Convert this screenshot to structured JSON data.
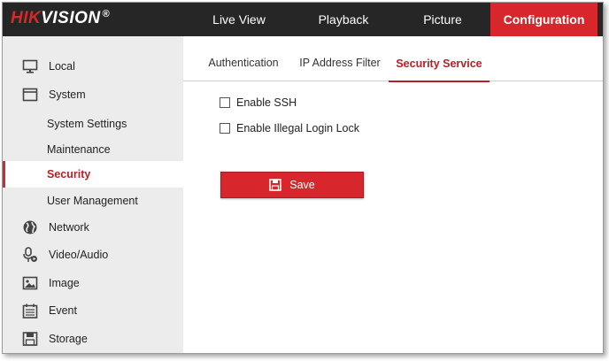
{
  "header": {
    "logo_text_red": "HIK",
    "logo_text_white": "VISION",
    "logo_reg": "®",
    "nav": [
      {
        "label": "Live View",
        "active": false
      },
      {
        "label": "Playback",
        "active": false
      },
      {
        "label": "Picture",
        "active": false
      },
      {
        "label": "Configuration",
        "active": true
      }
    ]
  },
  "sidebar": {
    "items": [
      {
        "label": "Local",
        "icon": "monitor-icon"
      },
      {
        "label": "System",
        "icon": "window-icon"
      },
      {
        "label": "System Settings"
      },
      {
        "label": "Maintenance"
      },
      {
        "label": "Security",
        "active": true
      },
      {
        "label": "User Management"
      },
      {
        "label": "Network",
        "icon": "globe-icon"
      },
      {
        "label": "Video/Audio",
        "icon": "mic-icon"
      },
      {
        "label": "Image",
        "icon": "image-icon"
      },
      {
        "label": "Event",
        "icon": "calendar-icon"
      },
      {
        "label": "Storage",
        "icon": "floppy-icon"
      }
    ]
  },
  "tabs": [
    {
      "label": "Authentication",
      "active": false
    },
    {
      "label": "IP Address Filter",
      "active": false
    },
    {
      "label": "Security Service",
      "active": true
    }
  ],
  "form": {
    "options": [
      {
        "label": "Enable SSH",
        "checked": false
      },
      {
        "label": "Enable Illegal Login Lock",
        "checked": false
      }
    ],
    "save_label": "Save"
  },
  "colors": {
    "accent": "#d7262c",
    "topbar": "#262626",
    "sidebar_bg": "#ececec"
  }
}
